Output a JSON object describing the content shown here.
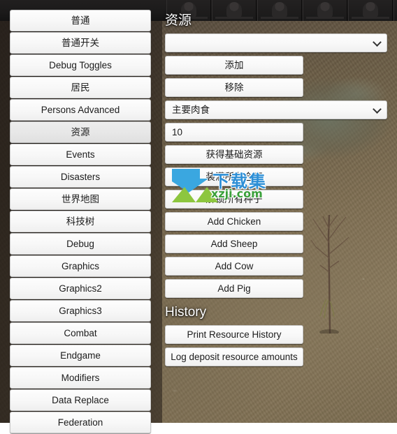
{
  "sidebar": {
    "items": [
      {
        "label": "普通",
        "active": false
      },
      {
        "label": "普通开关",
        "active": false
      },
      {
        "label": "Debug Toggles",
        "active": false
      },
      {
        "label": "居民",
        "active": false
      },
      {
        "label": "Persons Advanced",
        "active": false
      },
      {
        "label": "资源",
        "active": true
      },
      {
        "label": "Events",
        "active": false
      },
      {
        "label": "Disasters",
        "active": false
      },
      {
        "label": "世界地图",
        "active": false
      },
      {
        "label": "科技树",
        "active": false
      },
      {
        "label": "Debug",
        "active": false
      },
      {
        "label": "Graphics",
        "active": false
      },
      {
        "label": "Graphics2",
        "active": false
      },
      {
        "label": "Graphics3",
        "active": false
      },
      {
        "label": "Combat",
        "active": false
      },
      {
        "label": "Endgame",
        "active": false
      },
      {
        "label": "Modifiers",
        "active": false
      },
      {
        "label": "Data Replace",
        "active": false
      },
      {
        "label": "Federation",
        "active": false
      }
    ]
  },
  "panel": {
    "resources_title": "资源",
    "history_title": "History",
    "resource_select": {
      "value": "",
      "chevron": "chevron-down-icon"
    },
    "add_button": "添加",
    "remove_button": "移除",
    "food_select": {
      "value": "主要肉食",
      "chevron": "chevron-down-icon"
    },
    "amount_input": {
      "value": "10",
      "placeholder": ""
    },
    "get_base_resources_button": "获得基础资源",
    "fill_storage_button": "装满所有仓库",
    "unlock_seeds_button": "解锁所有种子",
    "add_chicken_button": "Add Chicken",
    "add_sheep_button": "Add Sheep",
    "add_cow_button": "Add Cow",
    "add_pig_button": "Add Pig",
    "print_history_button": "Print Resource History",
    "log_deposit_button": "Log deposit resource amounts"
  },
  "watermark": {
    "title": "下载集",
    "url": "xzji.com"
  },
  "colors": {
    "button_face": "#f8f8f8",
    "button_border": "#c9c9c9",
    "active_face": "#e7e7e7",
    "title_text": "#ffffff",
    "watermark_blue": "#2e8fd6",
    "watermark_green": "#3aa03a"
  }
}
